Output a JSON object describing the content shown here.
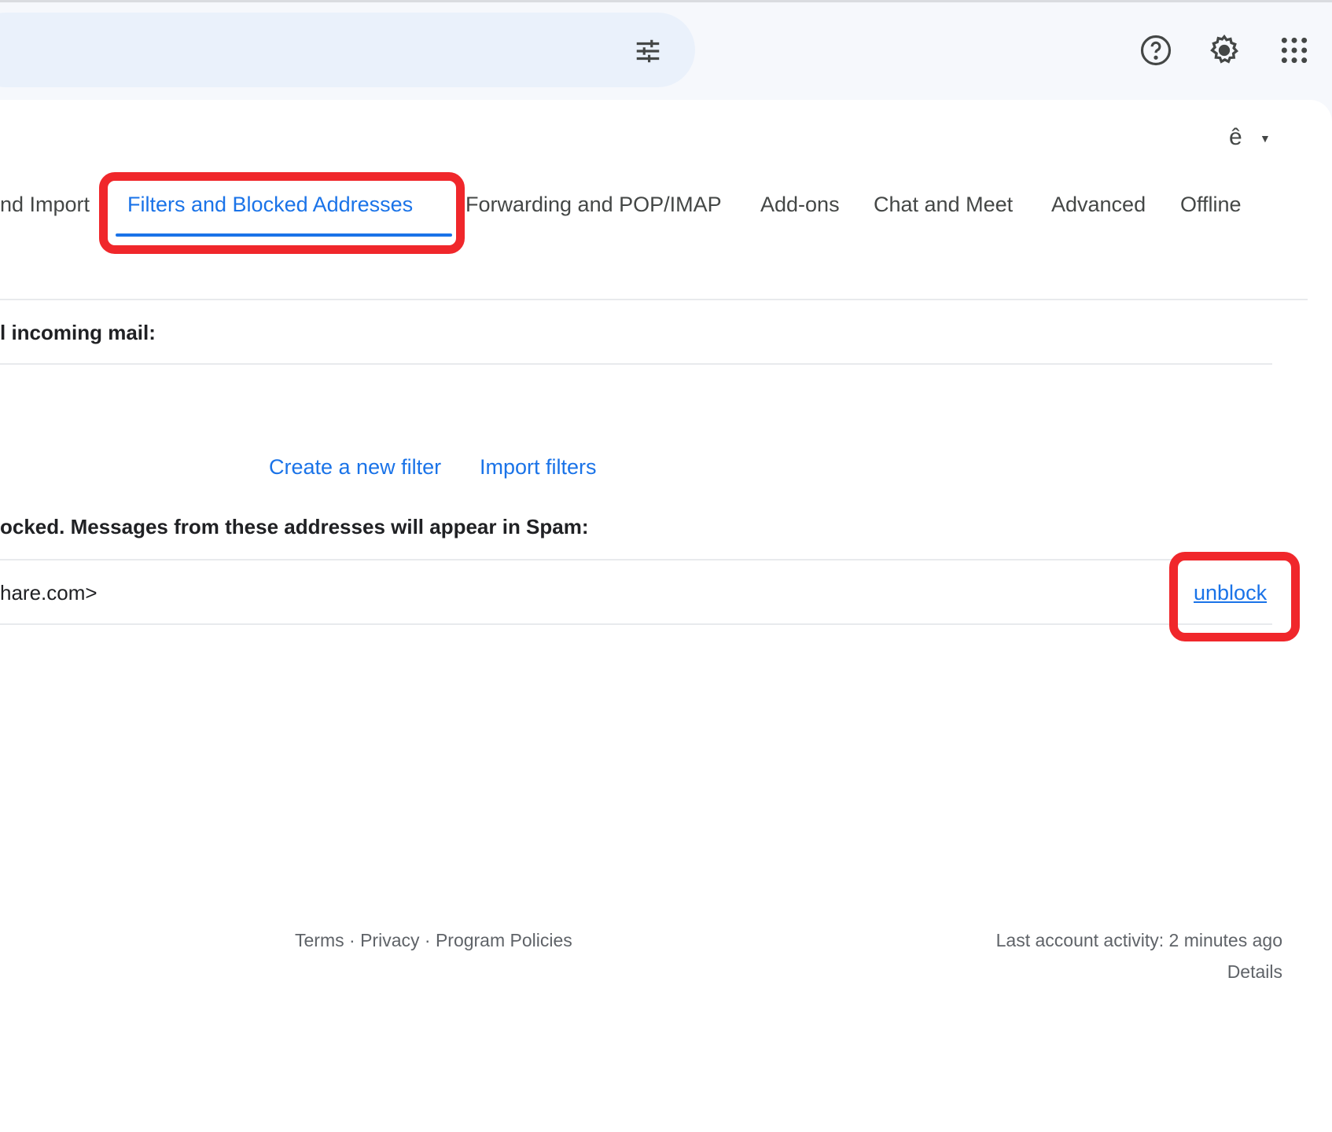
{
  "header": {
    "icons": [
      "filter-options-icon",
      "help-icon",
      "settings-gear-icon",
      "apps-grid-icon"
    ],
    "input_tool_label": "ê"
  },
  "tabs": [
    {
      "label": "nd Import"
    },
    {
      "label": "Filters and Blocked Addresses",
      "active": true
    },
    {
      "label": "Forwarding and POP/IMAP"
    },
    {
      "label": "Add-ons"
    },
    {
      "label": "Chat and Meet"
    },
    {
      "label": "Advanced"
    },
    {
      "label": "Offline"
    }
  ],
  "filters": {
    "heading": "l incoming mail:",
    "create_link": "Create a new filter",
    "import_link": "Import filters"
  },
  "blocked": {
    "heading": "ocked. Messages from these addresses will appear in Spam:",
    "rows": [
      {
        "address": "hare.com>",
        "action": "unblock"
      }
    ]
  },
  "footer": {
    "terms": "Terms",
    "privacy": "Privacy",
    "policies": "Program Policies",
    "separator": "·",
    "activity": "Last account activity: 2 minutes ago",
    "details": "Details"
  },
  "colors": {
    "accent": "#1a73e8",
    "highlight": "#f0272b"
  }
}
